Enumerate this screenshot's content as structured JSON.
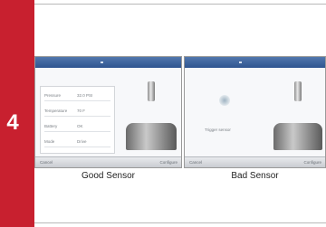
{
  "step": {
    "number": "4"
  },
  "good_panel": {
    "rows": [
      {
        "label": "Pressure",
        "value": "32.0 PSI"
      },
      {
        "label": "Temperature",
        "value": "70 F"
      },
      {
        "label": "Battery",
        "value": "OK"
      },
      {
        "label": "Mode",
        "value": "Drive"
      }
    ],
    "footer_left": "Cancel",
    "footer_right": "Configure"
  },
  "bad_panel": {
    "status_text": "Trigger sensor",
    "footer_left": "Cancel",
    "footer_right": "Configure"
  },
  "captions": {
    "good": "Good Sensor",
    "bad": "Bad Sensor"
  }
}
